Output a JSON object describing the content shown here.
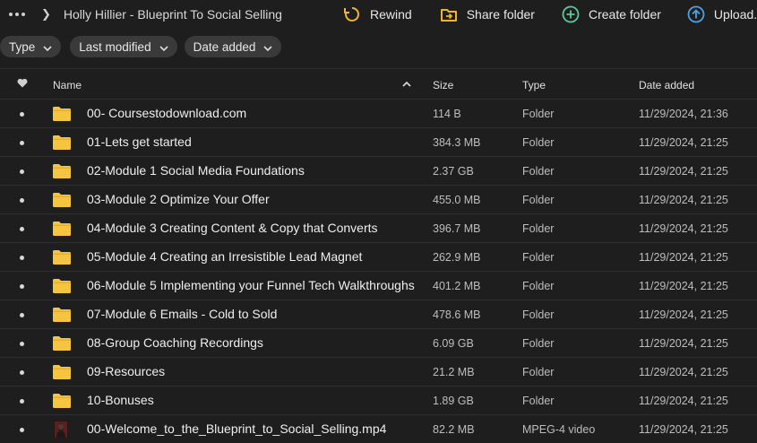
{
  "breadcrumb": {
    "title": "Holly Hillier - Blueprint To Social Selling"
  },
  "toolbar": {
    "rewind_label": "Rewind",
    "share_label": "Share folder",
    "create_label": "Create folder",
    "upload_label": "Upload..."
  },
  "filters": {
    "type_label": "Type",
    "last_modified_label": "Last modified",
    "date_added_label": "Date added"
  },
  "columns": {
    "name": "Name",
    "size": "Size",
    "type": "Type",
    "date_added": "Date added"
  },
  "colors": {
    "folder": "#f5c542",
    "accent_orange": "#f2b233",
    "accent_green": "#5cc99b",
    "accent_blue": "#4ea1e8"
  },
  "files": [
    {
      "name": "00- Coursestodownload.com",
      "size": "114 B",
      "type": "Folder",
      "date": "11/29/2024, 21:36",
      "icon": "folder-icon"
    },
    {
      "name": "01-Lets get started",
      "size": "384.3 MB",
      "type": "Folder",
      "date": "11/29/2024, 21:25",
      "icon": "folder-icon"
    },
    {
      "name": "02-Module 1 Social Media Foundations",
      "size": "2.37 GB",
      "type": "Folder",
      "date": "11/29/2024, 21:25",
      "icon": "folder-icon"
    },
    {
      "name": "03-Module 2 Optimize Your Offer",
      "size": "455.0 MB",
      "type": "Folder",
      "date": "11/29/2024, 21:25",
      "icon": "folder-icon"
    },
    {
      "name": "04-Module 3 Creating Content & Copy that Converts",
      "size": "396.7 MB",
      "type": "Folder",
      "date": "11/29/2024, 21:25",
      "icon": "folder-icon"
    },
    {
      "name": "05-Module 4 Creating an Irresistible Lead Magnet",
      "size": "262.9 MB",
      "type": "Folder",
      "date": "11/29/2024, 21:25",
      "icon": "folder-icon"
    },
    {
      "name": "06-Module 5 Implementing your Funnel Tech Walkthroughs",
      "size": "401.2 MB",
      "type": "Folder",
      "date": "11/29/2024, 21:25",
      "icon": "folder-icon"
    },
    {
      "name": "07-Module 6 Emails - Cold to Sold",
      "size": "478.6 MB",
      "type": "Folder",
      "date": "11/29/2024, 21:25",
      "icon": "folder-icon"
    },
    {
      "name": "08-Group Coaching Recordings",
      "size": "6.09 GB",
      "type": "Folder",
      "date": "11/29/2024, 21:25",
      "icon": "folder-icon"
    },
    {
      "name": "09-Resources",
      "size": "21.2 MB",
      "type": "Folder",
      "date": "11/29/2024, 21:25",
      "icon": "folder-icon"
    },
    {
      "name": "10-Bonuses",
      "size": "1.89 GB",
      "type": "Folder",
      "date": "11/29/2024, 21:25",
      "icon": "folder-icon"
    },
    {
      "name": "00-Welcome_to_the_Blueprint_to_Social_Selling.mp4",
      "size": "82.2 MB",
      "type": "MPEG-4 video",
      "date": "11/29/2024, 21:25",
      "icon": "video-thumbnail-icon"
    }
  ]
}
